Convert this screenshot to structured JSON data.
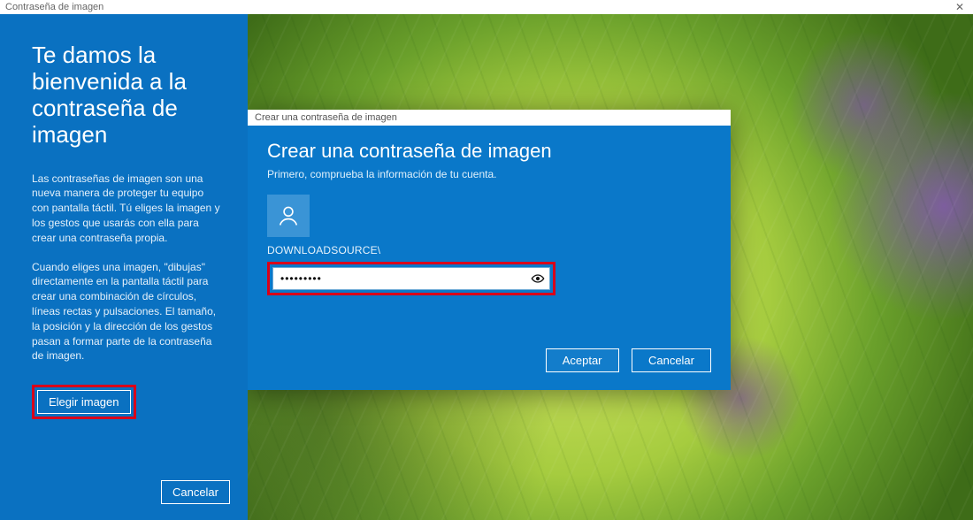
{
  "window": {
    "title": "Contraseña de imagen",
    "close_glyph": "✕"
  },
  "left": {
    "heading": "Te damos la bienvenida a la contraseña de imagen",
    "para1": "Las contraseñas de imagen son una nueva manera de proteger tu equipo con pantalla táctil. Tú eliges la imagen y los gestos que usarás con ella para crear una contraseña propia.",
    "para2": "Cuando eliges una imagen, \"dibujas\" directamente en la pantalla táctil para crear una combinación de círculos, líneas rectas y pulsaciones. El tamaño, la posición y la dirección de los gestos pasan a formar parte de la contraseña de imagen.",
    "choose_label": "Elegir imagen",
    "cancel_label": "Cancelar"
  },
  "dialog": {
    "title": "Crear una contraseña de imagen",
    "heading": "Crear una contraseña de imagen",
    "subtitle": "Primero, comprueba la información de tu cuenta.",
    "username": "DOWNLOADSOURCE\\",
    "password_value": "•••••••••",
    "accept_label": "Aceptar",
    "cancel_label": "Cancelar"
  }
}
